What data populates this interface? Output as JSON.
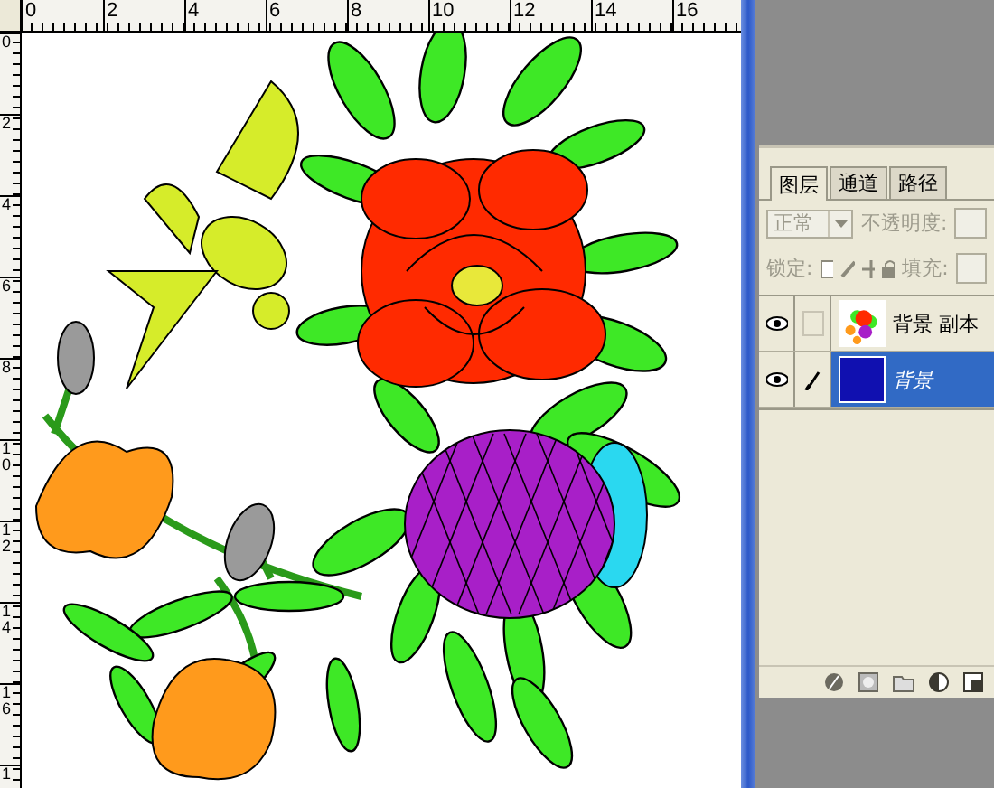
{
  "rulers": {
    "horizontal": [
      "0",
      "2",
      "4",
      "6",
      "8",
      "10",
      "12",
      "14",
      "16"
    ],
    "vertical": [
      "0",
      "2",
      "4",
      "6",
      "8",
      "10",
      "12",
      "14",
      "16",
      "1"
    ]
  },
  "layers_panel": {
    "tabs": [
      {
        "label": "图层",
        "selected": true
      },
      {
        "label": "通道",
        "selected": false
      },
      {
        "label": "路径",
        "selected": false
      }
    ],
    "blend_mode": {
      "value": "正常",
      "disabled": true
    },
    "opacity_label": "不透明度:",
    "lock_label": "锁定:",
    "fill_label": "填充:",
    "layers": [
      {
        "name": "背景 副本",
        "visible": true,
        "selected": false,
        "kind": "artwork"
      },
      {
        "name": "背景",
        "visible": true,
        "selected": true,
        "kind": "solid",
        "color": "#1010b0"
      }
    ]
  }
}
